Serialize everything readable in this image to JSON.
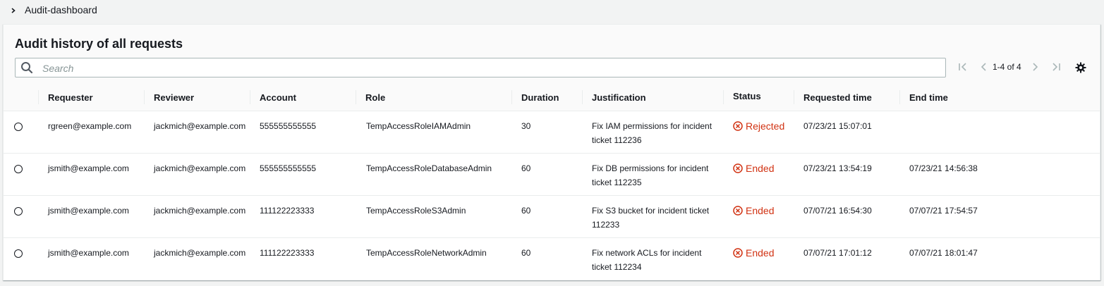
{
  "breadcrumb": {
    "label": "Audit-dashboard"
  },
  "panel": {
    "title": "Audit history of all requests",
    "search": {
      "placeholder": "Search",
      "value": ""
    },
    "pagination": {
      "text": "1-4 of 4"
    }
  },
  "table": {
    "columns": [
      "Requester",
      "Reviewer",
      "Account",
      "Role",
      "Duration",
      "Justification",
      "Status",
      "Requested time",
      "End time"
    ],
    "rows": [
      {
        "requester": "rgreen@example.com",
        "reviewer": "jackmich@example.com",
        "account": "555555555555",
        "role": "TempAccessRoleIAMAdmin",
        "duration": "30",
        "justification": "Fix IAM permissions for incident ticket 112236",
        "status": "Rejected",
        "requested": "07/23/21 15:07:01",
        "end": ""
      },
      {
        "requester": "jsmith@example.com",
        "reviewer": "jackmich@example.com",
        "account": "555555555555",
        "role": "TempAccessRoleDatabaseAdmin",
        "duration": "60",
        "justification": "Fix DB permissions for incident ticket 112235",
        "status": "Ended",
        "requested": "07/23/21 13:54:19",
        "end": "07/23/21 14:56:38"
      },
      {
        "requester": "jsmith@example.com",
        "reviewer": "jackmich@example.com",
        "account": "111122223333",
        "role": "TempAccessRoleS3Admin",
        "duration": "60",
        "justification": "Fix S3 bucket for incident ticket 112233",
        "status": "Ended",
        "requested": "07/07/21 16:54:30",
        "end": "07/07/21 17:54:57"
      },
      {
        "requester": "jsmith@example.com",
        "reviewer": "jackmich@example.com",
        "account": "111122223333",
        "role": "TempAccessRoleNetworkAdmin",
        "duration": "60",
        "justification": "Fix network ACLs for incident ticket 112234",
        "status": "Ended",
        "requested": "07/07/21 17:01:12",
        "end": "07/07/21 18:01:47"
      }
    ]
  },
  "colors": {
    "status_error": "#d13212",
    "text": "#16191f",
    "icon_disabled": "#aab7b8"
  }
}
